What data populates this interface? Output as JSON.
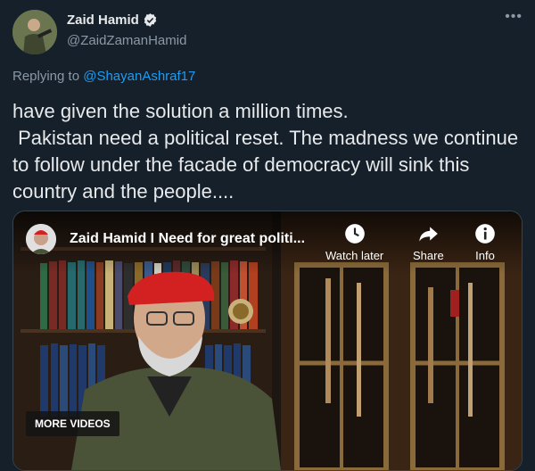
{
  "author": {
    "name": "Zaid Hamid",
    "handle": "@ZaidZamanHamid"
  },
  "reply": {
    "prefix": "Replying to",
    "mention": "@ShayanAshraf17"
  },
  "tweet": {
    "text": "have given the solution a million times.\n Pakistan need a political reset. The madness we continue to follow under the facade of democracy will sink this country and the people...."
  },
  "video": {
    "title": "Zaid Hamid I Need for great politi...",
    "actions": {
      "watch_later": "Watch later",
      "share": "Share",
      "info": "Info"
    },
    "more_videos": "MORE VIDEOS"
  },
  "icons": {
    "verified": "verified-badge-icon",
    "more": "more-dots-icon",
    "watch_later": "clock-icon",
    "share": "share-arrow-icon",
    "info": "info-icon"
  },
  "colors": {
    "background": "#15202b",
    "link": "#1d9bf0",
    "muted": "#8b98a5"
  }
}
